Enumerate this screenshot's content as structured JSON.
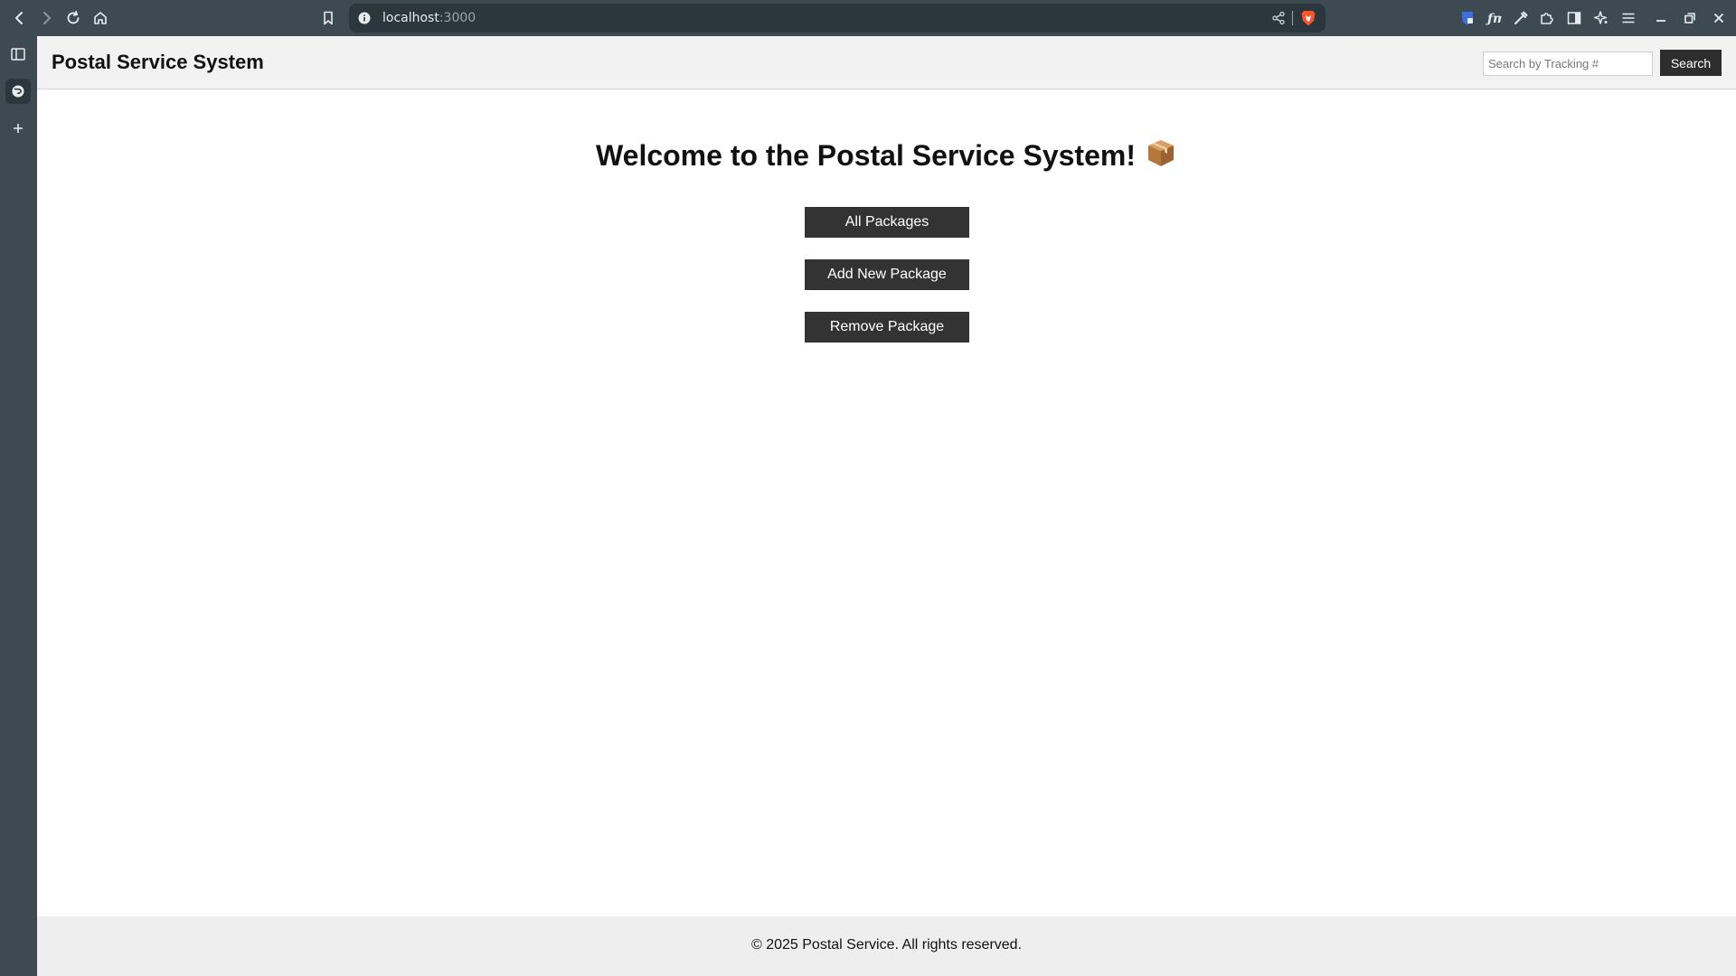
{
  "browser": {
    "url_host": "localhost",
    "url_port": ":3000"
  },
  "header": {
    "title": "Postal Service System",
    "search_placeholder": "Search by Tracking #",
    "search_label": "Search"
  },
  "main": {
    "welcome": "Welcome to the Postal Service System!",
    "buttons": [
      "All Packages",
      "Add New Package",
      "Remove Package"
    ]
  },
  "footer": {
    "text": "© 2025 Postal Service. All rights reserved."
  },
  "icons": {
    "welcome_emoji": "package-icon"
  },
  "colors": {
    "chrome": "#3d4a52",
    "button": "#333333",
    "header_bg": "#f2f2f2",
    "footer_bg": "#eeeeee"
  }
}
